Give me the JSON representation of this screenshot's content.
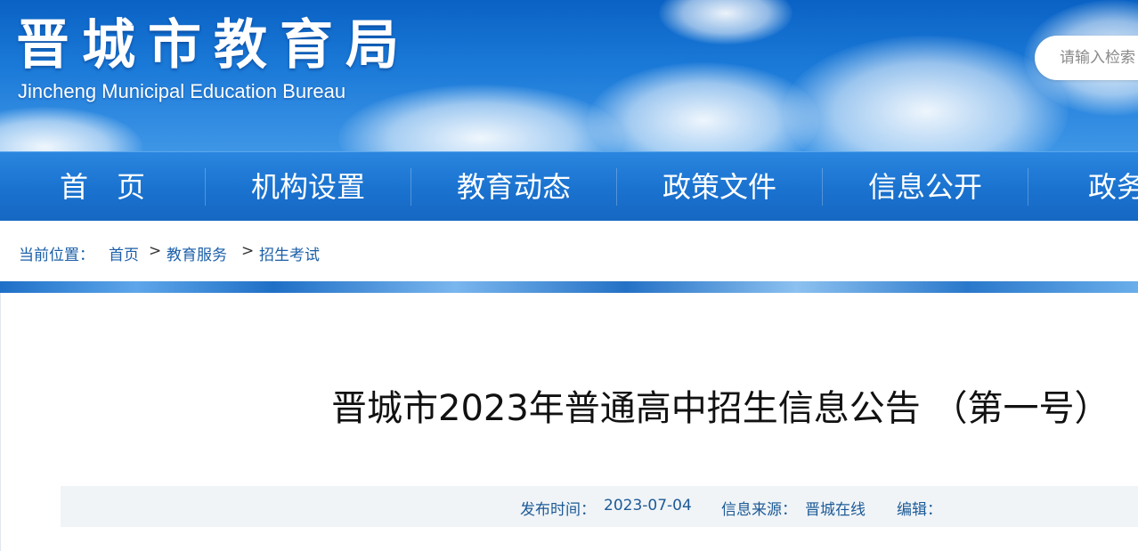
{
  "header": {
    "title_zh": "晋城市教育局",
    "title_en": "Jincheng Municipal Education Bureau",
    "search_placeholder": "请输入检索"
  },
  "nav": {
    "items": [
      "首　页",
      "机构设置",
      "教育动态",
      "政策文件",
      "信息公开",
      "政务服"
    ]
  },
  "breadcrumb": {
    "label": "当前位置：",
    "items": [
      "首页",
      "教育服务",
      "招生考试"
    ],
    "separator": ">"
  },
  "article": {
    "title": "晋城市2023年普通高中招生信息公告 （第一号）",
    "publish_label": "发布时间：",
    "publish_date": "2023-07-04",
    "source_label": "信息来源：",
    "source": "晋城在线",
    "editor_label": "编辑："
  },
  "colors": {
    "banner": "#1b7ad8",
    "nav": "#1a72cf",
    "link": "#1b5fa8",
    "meta_bg": "#f0f4f7"
  }
}
